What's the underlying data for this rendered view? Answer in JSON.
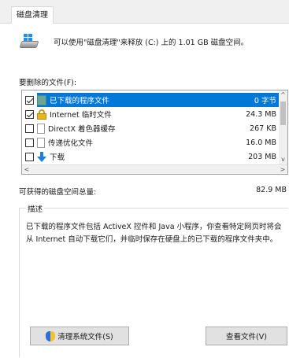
{
  "tab": {
    "label": "磁盘清理"
  },
  "info": {
    "text": "可以使用\"磁盘清理\"来释放 (C:) 上的 1.01 GB 磁盘空间。"
  },
  "files_section": {
    "label": "要删除的文件(F):"
  },
  "files": [
    {
      "name": "已下载的程序文件",
      "size": "0 字节",
      "checked": true,
      "selected": true,
      "icon": "program-files-icon"
    },
    {
      "name": "Internet 临时文件",
      "size": "24.3 MB",
      "checked": true,
      "selected": false,
      "icon": "lock-icon"
    },
    {
      "name": "DirectX 着色器缓存",
      "size": "267 KB",
      "checked": false,
      "selected": false,
      "icon": "document-icon"
    },
    {
      "name": "传递优化文件",
      "size": "16.0 MB",
      "checked": false,
      "selected": false,
      "icon": "document-icon"
    },
    {
      "name": "下载",
      "size": "203 MB",
      "checked": false,
      "selected": false,
      "icon": "download-arrow-icon"
    }
  ],
  "scroll": {
    "up": "^",
    "down": "v",
    "left": "<",
    "right": ">"
  },
  "total": {
    "label": "可获得的磁盘空间总量:",
    "value": "82.9 MB"
  },
  "description": {
    "title": "描述",
    "text": "已下载的程序文件包括 ActiveX 控件和 Java 小程序，你查看特定网页时将会从 Internet 自动下载它们，并临时保存在硬盘上的已下载的程序文件夹中。"
  },
  "buttons": {
    "clean_system": "清理系统文件(S)",
    "view_files": "查看文件(V)"
  },
  "colors": {
    "selection": "#0078d7",
    "shield_blue": "#2f6fd6",
    "shield_yellow": "#f2c12e"
  }
}
